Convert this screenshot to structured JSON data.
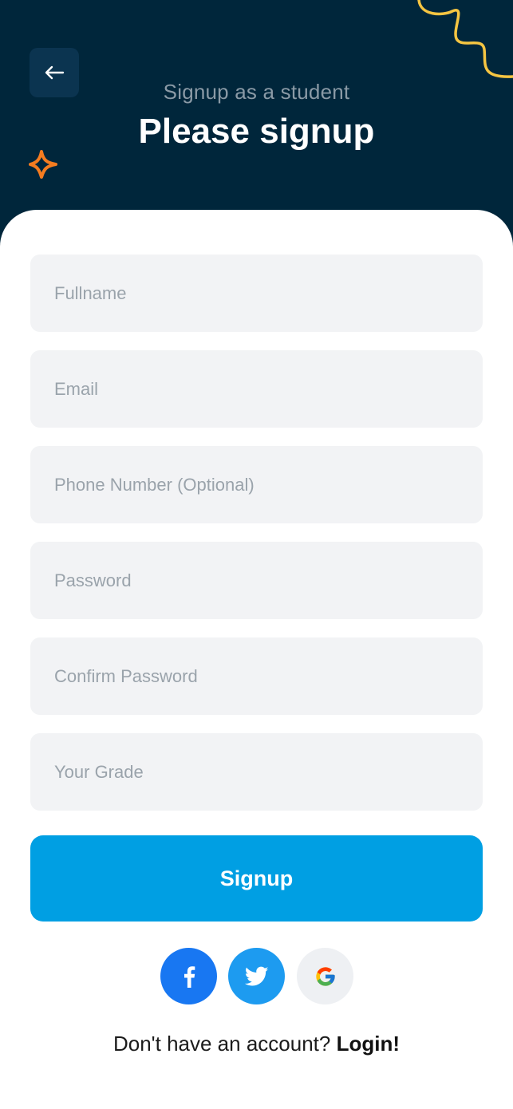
{
  "header": {
    "subtitle": "Signup as a student",
    "title": "Please signup",
    "background_color": "#00263b",
    "accent_squiggle_color": "#f5c542",
    "accent_star_color": "#f47c20"
  },
  "form": {
    "fields": [
      {
        "placeholder": "Fullname",
        "value": ""
      },
      {
        "placeholder": "Email",
        "value": ""
      },
      {
        "placeholder": "Phone Number (Optional)",
        "value": ""
      },
      {
        "placeholder": "Password",
        "value": ""
      },
      {
        "placeholder": "Confirm Password",
        "value": ""
      },
      {
        "placeholder": "Your Grade",
        "value": ""
      }
    ],
    "submit_label": "Signup",
    "submit_color": "#009fe3"
  },
  "social": {
    "buttons": [
      {
        "icon": "facebook-icon",
        "color": "#1877f2"
      },
      {
        "icon": "twitter-icon",
        "color": "#1d9bf0"
      },
      {
        "icon": "google-icon",
        "color": "#eef0f3"
      }
    ]
  },
  "footer": {
    "prompt": "Don't have an account?",
    "login_label": "Login!"
  }
}
